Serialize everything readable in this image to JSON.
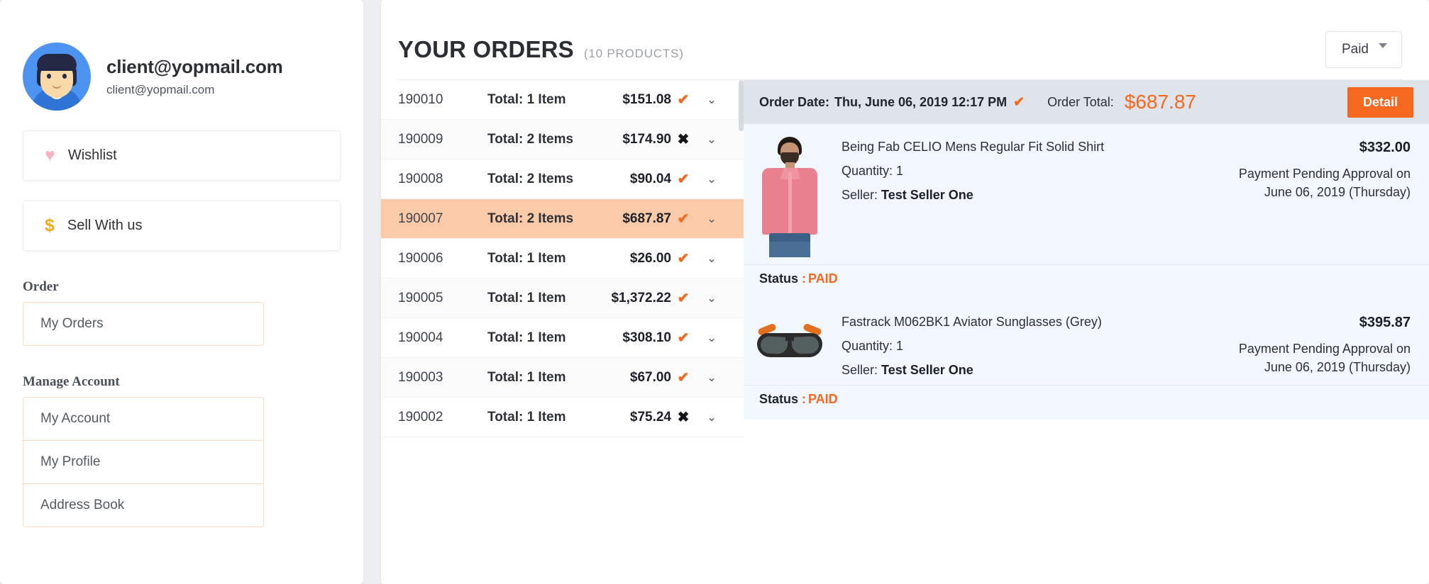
{
  "sidebar": {
    "profile": {
      "name": "client@yopmail.com",
      "email": "client@yopmail.com",
      "avatar_icon": "user-avatar"
    },
    "quick_links": [
      {
        "label": "Wishlist",
        "icon": "heart-icon",
        "icon_glyph": "♥"
      },
      {
        "label": "Sell With us",
        "icon": "dollar-icon",
        "icon_glyph": "$"
      }
    ],
    "groups": [
      {
        "title": "Order",
        "items": [
          {
            "label": "My Orders"
          }
        ]
      },
      {
        "title": "Manage Account",
        "items": [
          {
            "label": "My Account"
          },
          {
            "label": "My Profile"
          },
          {
            "label": "Address Book"
          }
        ]
      }
    ]
  },
  "main": {
    "title": "YOUR ORDERS",
    "subtitle": "(10 PRODUCTS)",
    "filter": {
      "selected": "Paid",
      "icon": "chevron-down-icon"
    },
    "orders": [
      {
        "id": "190010",
        "items": "Total: 1 Item",
        "price": "$151.08",
        "paid": true,
        "mark": "✔",
        "chevron": "⌄"
      },
      {
        "id": "190009",
        "items": "Total: 2 Items",
        "price": "$174.90",
        "paid": false,
        "mark": "✖",
        "chevron": "⌄"
      },
      {
        "id": "190008",
        "items": "Total: 2 Items",
        "price": "$90.04",
        "paid": true,
        "mark": "✔",
        "chevron": "⌄"
      },
      {
        "id": "190007",
        "items": "Total: 2 Items",
        "price": "$687.87",
        "paid": true,
        "mark": "✔",
        "chevron": "⌄"
      },
      {
        "id": "190006",
        "items": "Total: 1 Item",
        "price": "$26.00",
        "paid": true,
        "mark": "✔",
        "chevron": "⌄"
      },
      {
        "id": "190005",
        "items": "Total: 1 Item",
        "price": "$1,372.22",
        "paid": true,
        "mark": "✔",
        "chevron": "⌄"
      },
      {
        "id": "190004",
        "items": "Total: 1 Item",
        "price": "$308.10",
        "paid": true,
        "mark": "✔",
        "chevron": "⌄"
      },
      {
        "id": "190003",
        "items": "Total: 1 Item",
        "price": "$67.00",
        "paid": true,
        "mark": "✔",
        "chevron": "⌄"
      },
      {
        "id": "190002",
        "items": "Total: 1 Item",
        "price": "$75.24",
        "paid": false,
        "mark": "✖",
        "chevron": "⌄"
      }
    ],
    "selected_order_id": "190007",
    "detail": {
      "order_date_label": "Order Date:",
      "order_date_value": "Thu, June 06, 2019 12:17 PM",
      "order_date_check": "✔",
      "order_total_label": "Order Total:",
      "order_total_value": "$687.87",
      "detail_button": "Detail",
      "products": [
        {
          "image_icon": "shirt-product-image",
          "name": "Being Fab CELIO Mens Regular Fit Solid Shirt",
          "quantity": "Quantity: 1",
          "seller_label": "Seller:",
          "seller_name": "Test Seller One",
          "price": "$332.00",
          "pending_line1": "Payment Pending Approval on",
          "pending_line2": "June 06, 2019 (Thursday)",
          "status_label": "Status",
          "status_value": "PAID"
        },
        {
          "image_icon": "sunglasses-product-image",
          "name": "Fastrack M062BK1 Aviator Sunglasses (Grey)",
          "quantity": "Quantity: 1",
          "seller_label": "Seller:",
          "seller_name": "Test Seller One",
          "price": "$395.87",
          "pending_line1": "Payment Pending Approval on",
          "pending_line2": "June 06, 2019 (Thursday)",
          "status_label": "Status",
          "status_value": "PAID"
        }
      ]
    }
  },
  "colors": {
    "accent_orange": "#f4681f",
    "selected_row": "#fbcba9",
    "detail_bar": "#dfe3ea",
    "product_bg": "#f2f6fd",
    "heart_pink": "#f9b4c4",
    "dollar_gold": "#f0ac1e",
    "menu_border": "#fadcc4"
  }
}
